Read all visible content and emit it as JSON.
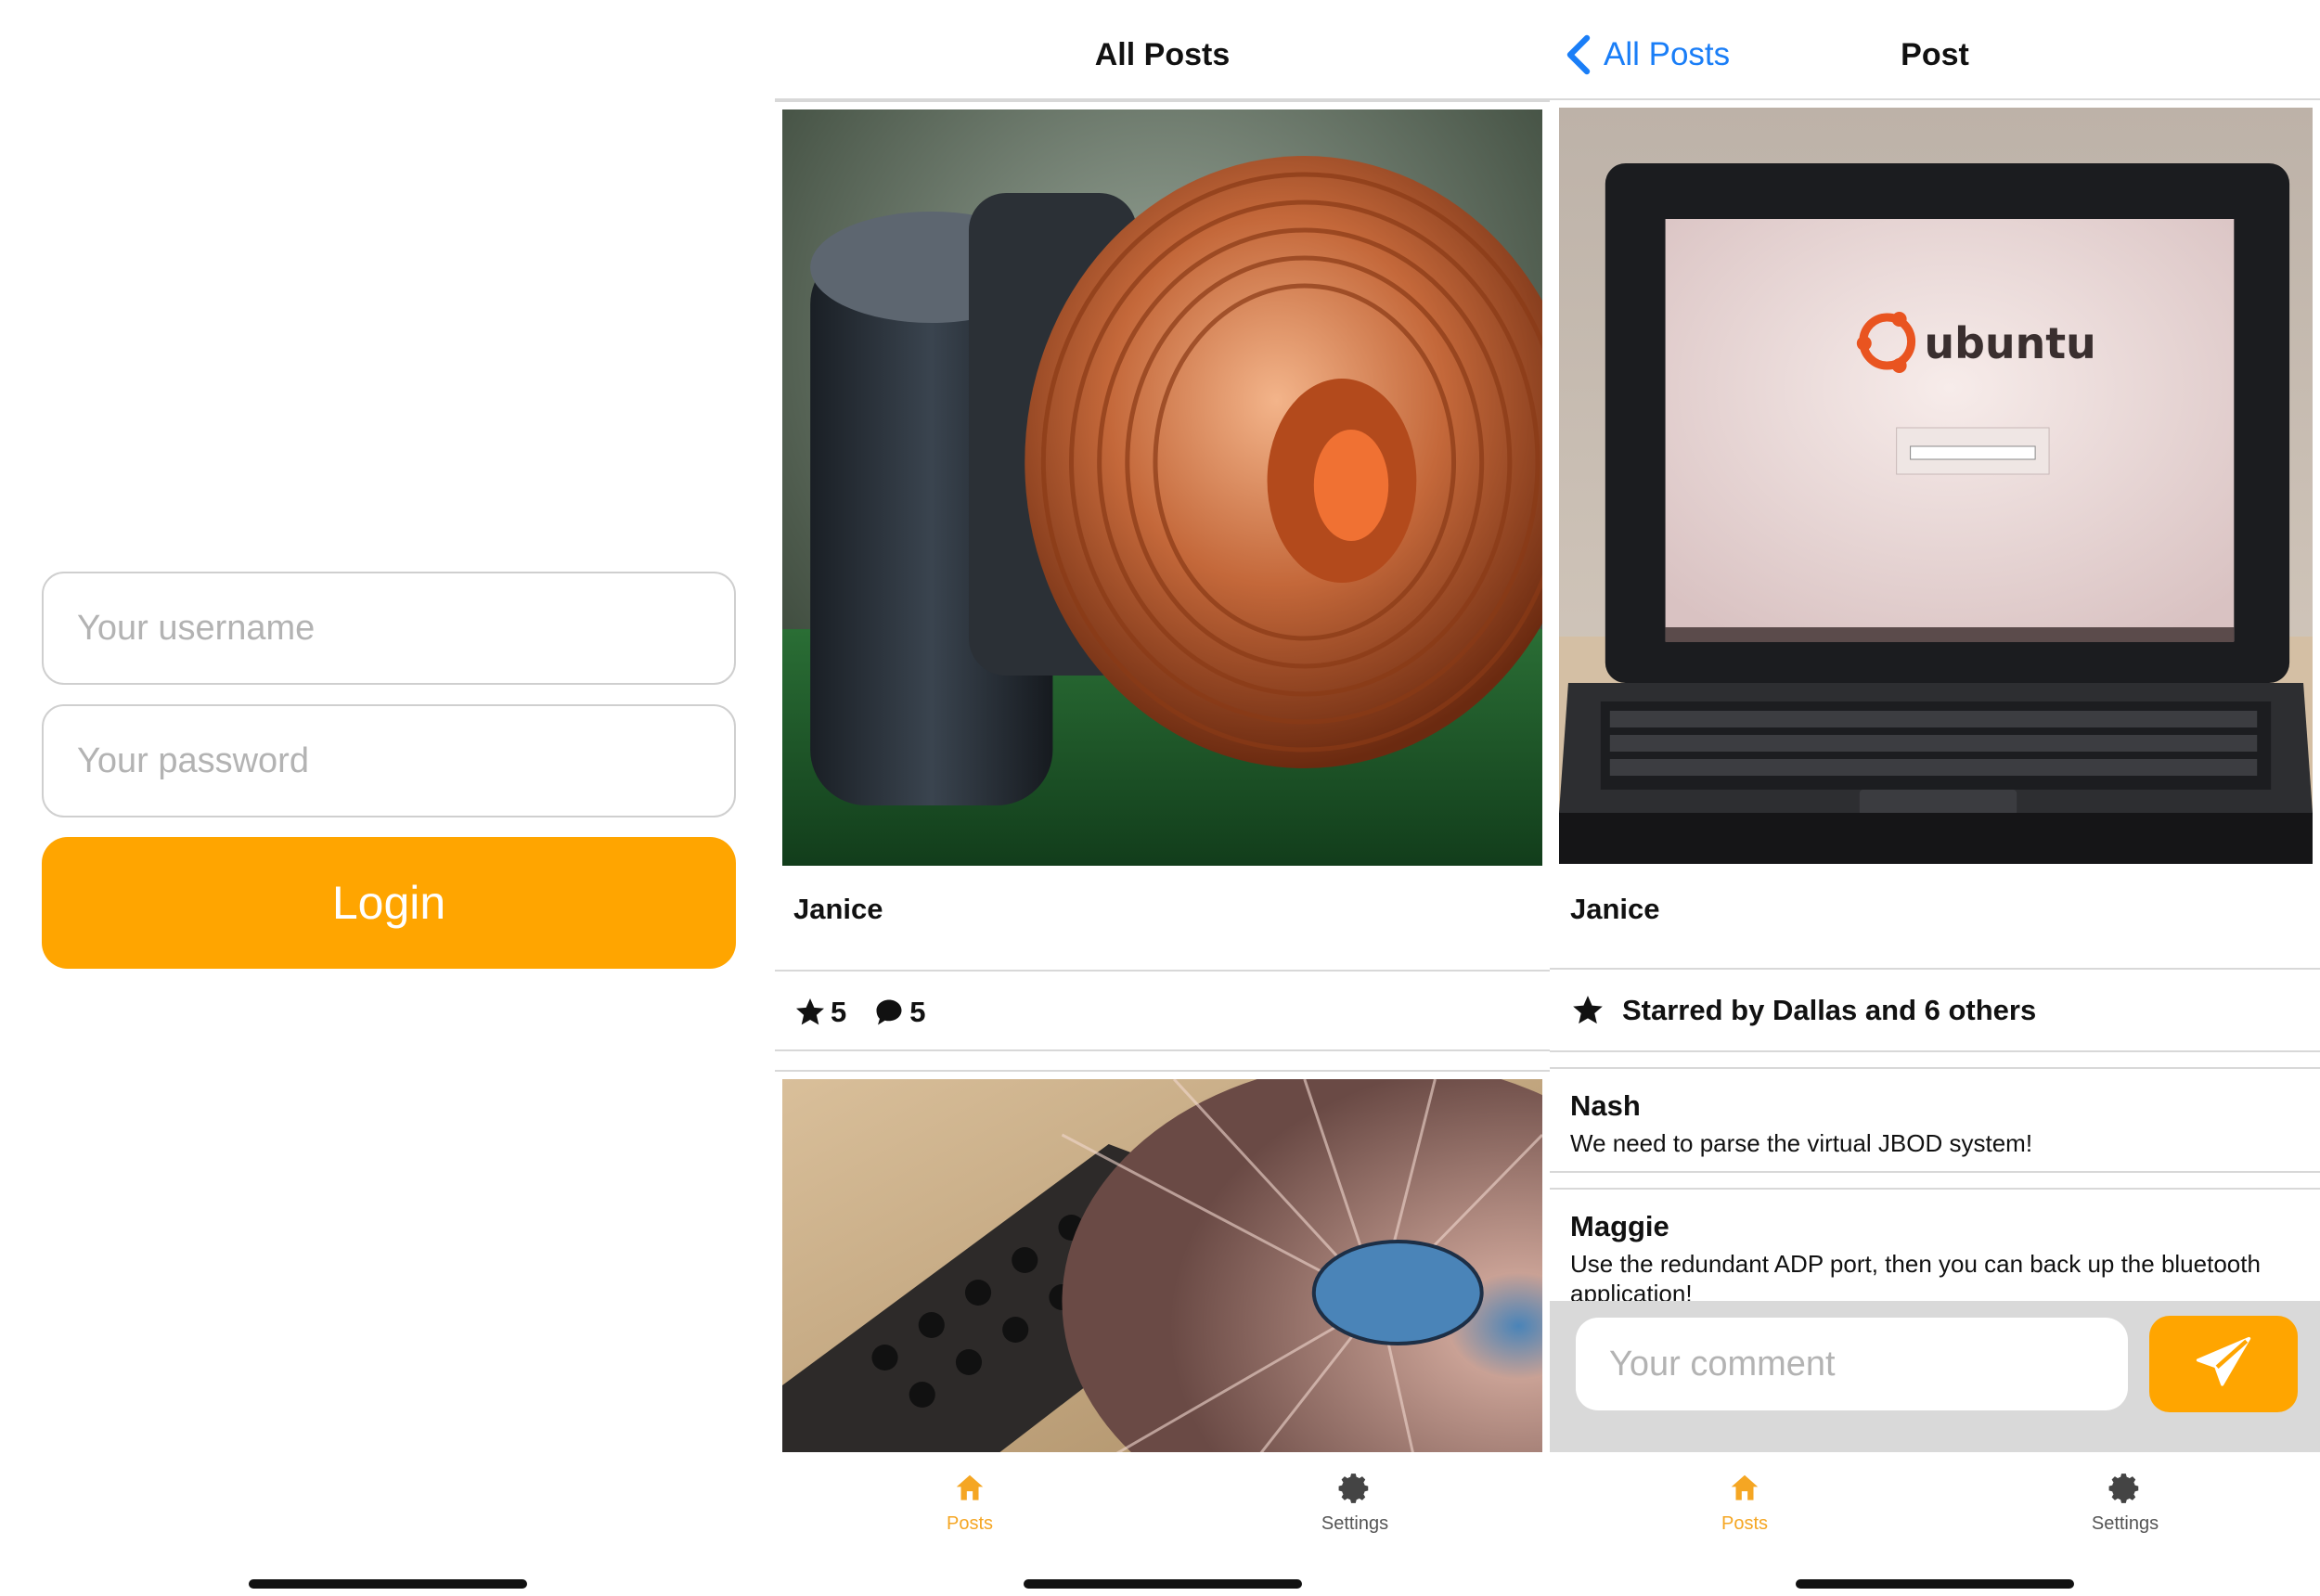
{
  "login": {
    "username_placeholder": "Your username",
    "password_placeholder": "Your password",
    "login_label": "Login"
  },
  "feed": {
    "title": "All Posts",
    "posts": [
      {
        "author": "Janice",
        "stars": "5",
        "comments": "5",
        "photo": "copper toroidal inductor and capacitor on circuit board"
      },
      {
        "photo": "DJ mixer and turntable"
      }
    ]
  },
  "post": {
    "back_label": "All Posts",
    "title": "Post",
    "photo": "laptop showing ubuntu login screen",
    "author": "Janice",
    "starred_text": "Starred by Dallas and 6 others",
    "comments": [
      {
        "author": "Nash",
        "text": "We need to parse the virtual JBOD system!"
      },
      {
        "author": "Maggie",
        "text": "Use the redundant ADP port, then you can back up the bluetooth application!"
      }
    ],
    "comment_placeholder": "Your comment"
  },
  "tabbar": {
    "tabs": [
      {
        "label": "Posts",
        "icon": "home-icon",
        "active": true
      },
      {
        "label": "Settings",
        "icon": "gear-icon",
        "active": false
      }
    ]
  },
  "colors": {
    "accent": "#ffa500",
    "link": "#1a7ef7",
    "tab_active": "#f5a623",
    "divider": "#d8d8d8"
  }
}
